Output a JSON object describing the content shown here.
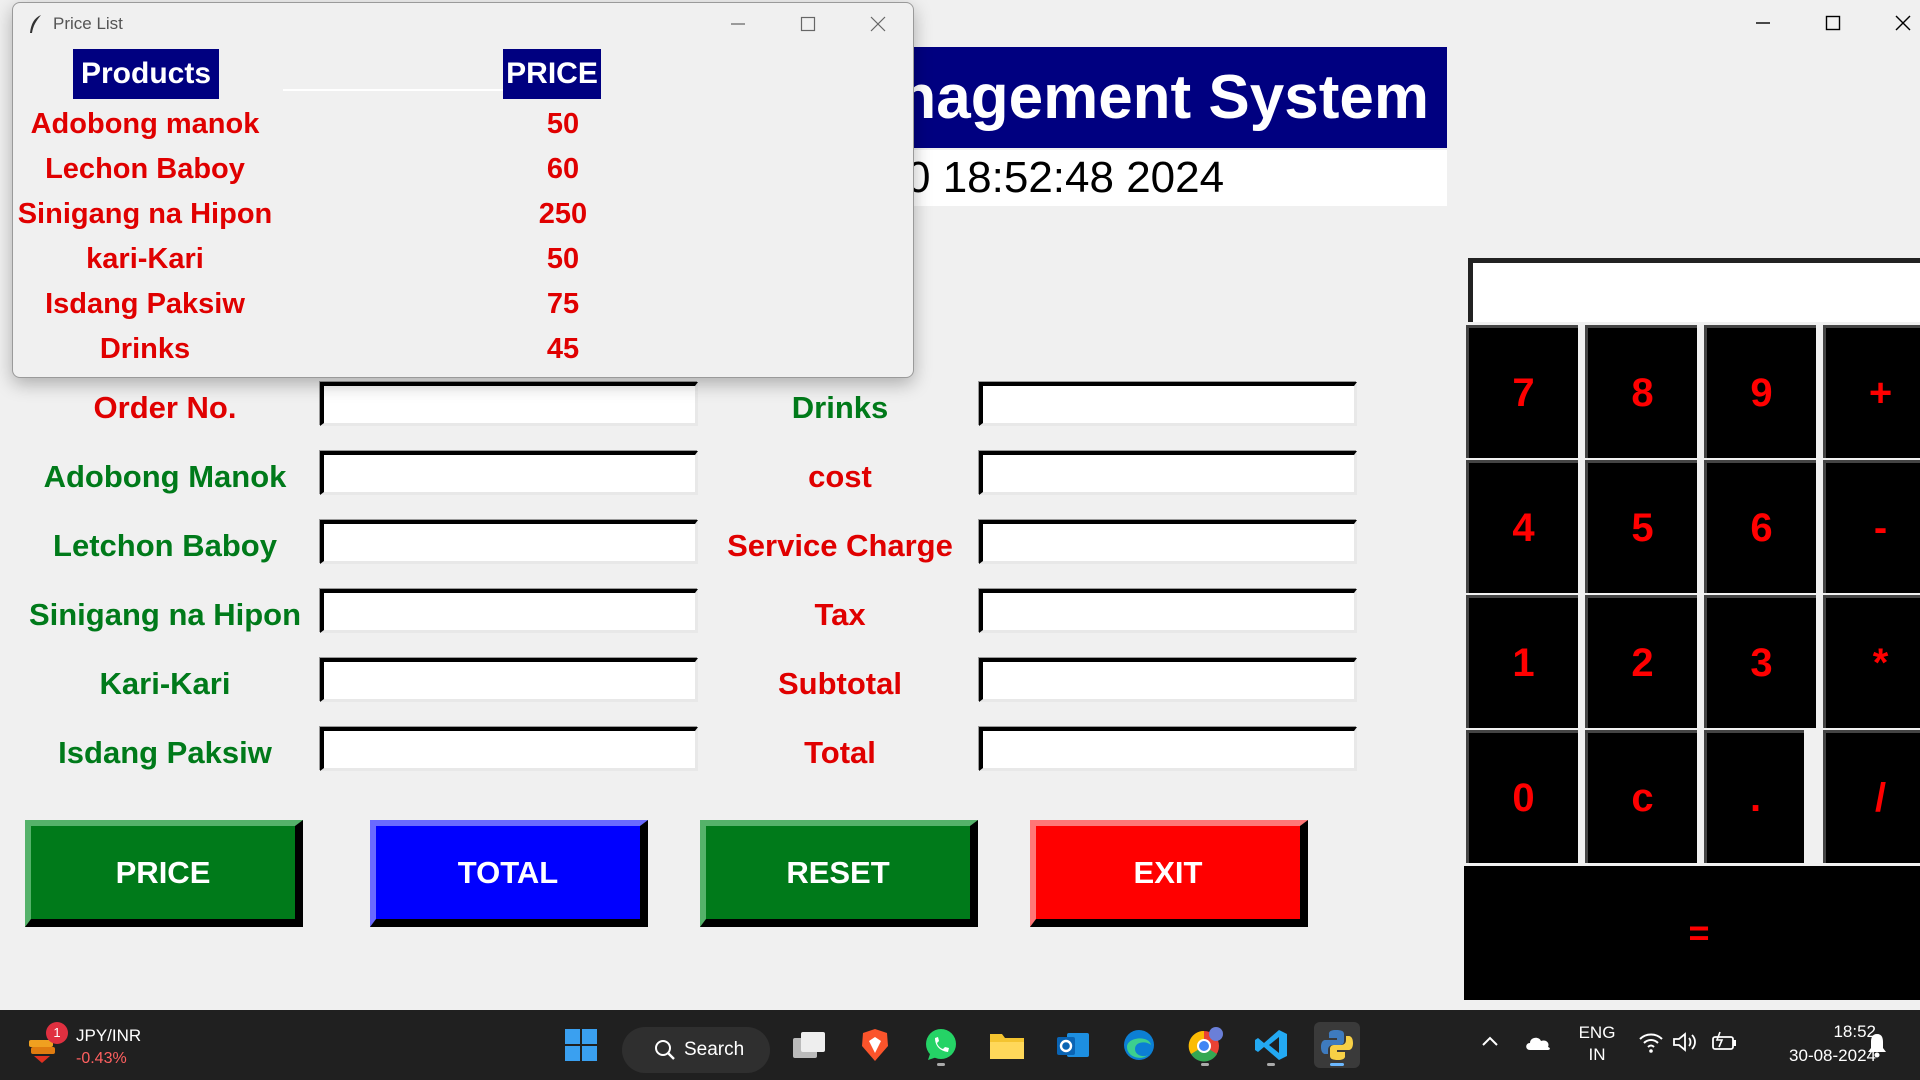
{
  "main_window": {
    "banner_text": "nagement System",
    "clock_text": "0 18:52:48 2024",
    "left_labels": [
      "Order No.",
      "Adobong Manok",
      "Letchon Baboy",
      "Sinigang na Hipon",
      "Kari-Kari",
      "Isdang Paksiw"
    ],
    "right_labels": [
      "Drinks",
      "cost",
      "Service Charge",
      "Tax",
      "Subtotal",
      "Total"
    ],
    "buttons": {
      "price": "PRICE",
      "total": "TOTAL",
      "reset": "RESET",
      "exit": "EXIT"
    },
    "calculator": {
      "keys": [
        "7",
        "8",
        "9",
        "+",
        "4",
        "5",
        "6",
        "-",
        "1",
        "2",
        "3",
        "*",
        "0",
        "c",
        ".",
        "/"
      ],
      "equals": "="
    },
    "colors": {
      "banner": "#000080",
      "label_green": "#007a1a",
      "label_red": "#e00000",
      "key_text": "#ff0000"
    }
  },
  "price_window": {
    "title": "Price List",
    "header_products": "Products",
    "header_price": "PRICE",
    "items": [
      {
        "name": "Adobong manok",
        "price": "50"
      },
      {
        "name": "Lechon Baboy",
        "price": "60"
      },
      {
        "name": "Sinigang na Hipon",
        "price": "250"
      },
      {
        "name": "kari-Kari",
        "price": "50"
      },
      {
        "name": "Isdang Paksiw",
        "price": "75"
      },
      {
        "name": "Drinks",
        "price": "45"
      }
    ]
  },
  "taskbar": {
    "ticker_symbol": "JPY/INR",
    "ticker_change": "-0.43%",
    "ticker_badge": "1",
    "search_label": "Search",
    "language": "ENG",
    "region": "IN",
    "time": "18:52",
    "date": "30-08-2024",
    "icons": [
      "start-icon",
      "search-icon",
      "task-view-icon",
      "brave-icon",
      "whatsapp-icon",
      "file-explorer-icon",
      "outlook-icon",
      "edge-icon",
      "chrome-icon",
      "vscode-icon",
      "python-icon"
    ]
  }
}
